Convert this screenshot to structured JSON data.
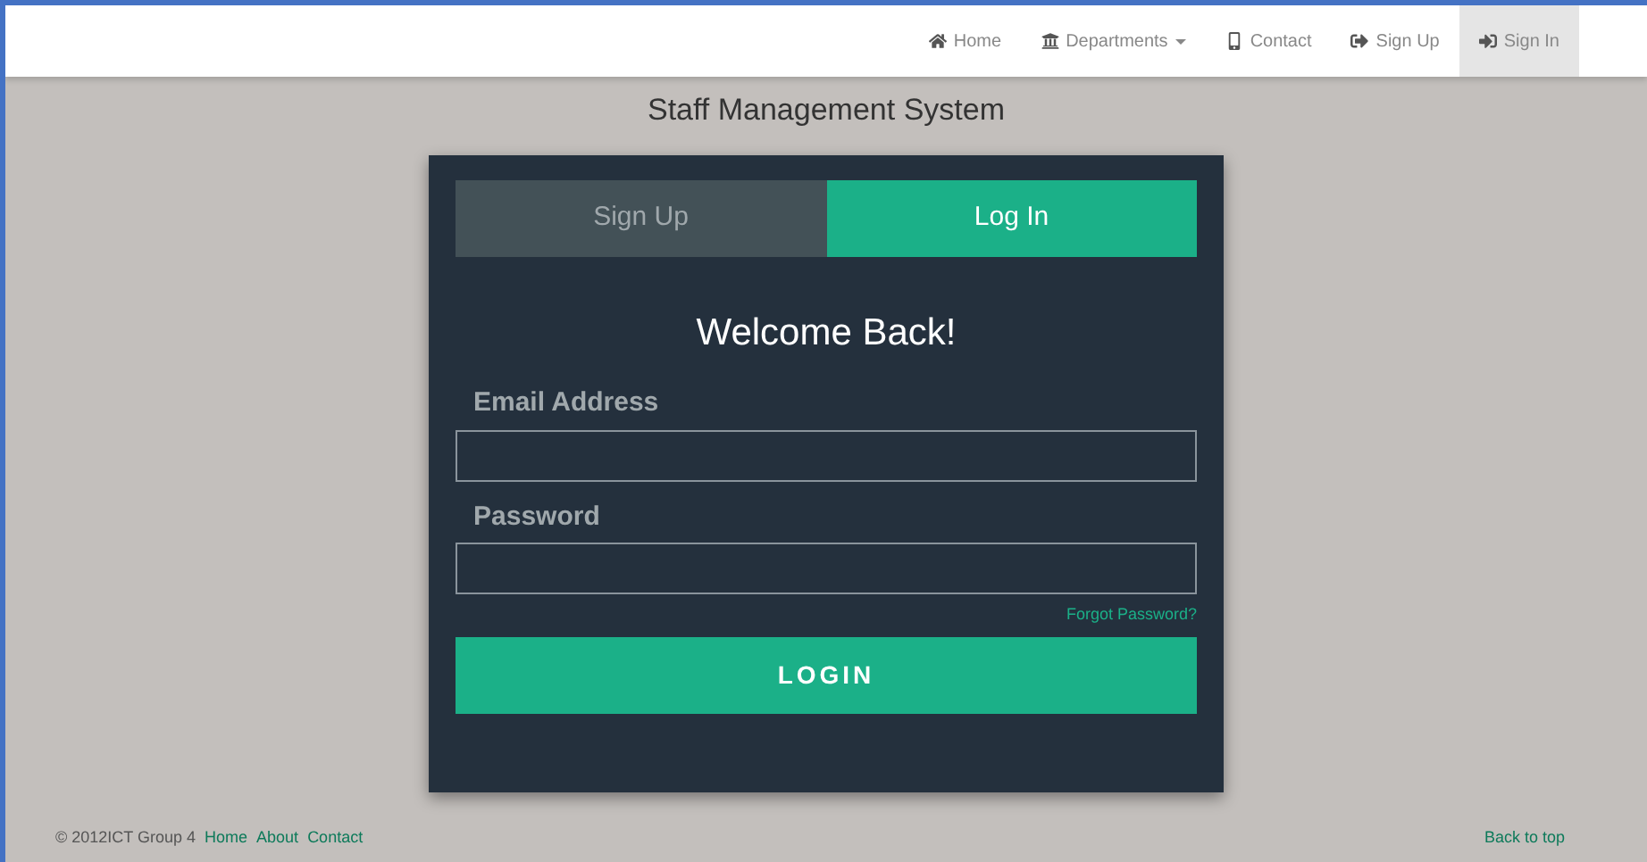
{
  "navbar": {
    "items": [
      {
        "label": "Home",
        "dropdown": false,
        "selected": false
      },
      {
        "label": "Departments",
        "dropdown": true,
        "selected": false
      },
      {
        "label": "Contact",
        "dropdown": false,
        "selected": false
      },
      {
        "label": "Sign Up",
        "dropdown": false,
        "selected": false
      },
      {
        "label": "Sign In",
        "dropdown": false,
        "selected": true
      }
    ]
  },
  "page_title": "Staff Management System",
  "form": {
    "tabs": [
      {
        "label": "Sign Up",
        "selected": false
      },
      {
        "label": "Log In",
        "selected": true
      }
    ],
    "heading": "Welcome Back!",
    "fields": [
      {
        "label": "Email Address"
      },
      {
        "label": "Password"
      }
    ],
    "forgot_link": "Forgot Password?",
    "submit": "LOGIN"
  },
  "footer": {
    "copyright": "© 2012ICT Group 4",
    "links": [
      "Home",
      "About",
      "Contact"
    ],
    "back_to_top": "Back to top"
  }
}
